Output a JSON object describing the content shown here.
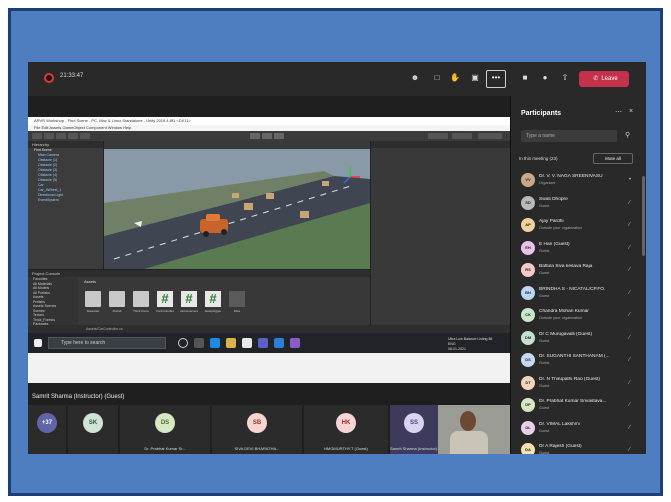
{
  "meeting": {
    "timer": "21:33:47",
    "more_label": "•••",
    "leave_label": "Leave",
    "presenter_label": "Samrit Sharma (Instructor) (Guest)"
  },
  "unity": {
    "window_title": "ARVR Workshop - Find Scene - PC, Mac & Linux Standalone - Unity 2019.4.8f1 <DX11>",
    "menu": "File  Edit  Assets  GameObject  Component  Window  Help",
    "hierarchy_title": "Hierarchy",
    "hierarchy_items": [
      "Find Scene",
      "Main Camera",
      "Obstacle (1)",
      "Obstacle (2)",
      "Obstacle (3)",
      "Obstacle (4)",
      "Obstacle (5)",
      "Car",
      "Car_4Wheel_1",
      "Directional Light",
      "EventSystem"
    ],
    "project_title": "Project   Console",
    "project_tree": [
      "Favorites",
      "All Materials",
      "All Models",
      "All Prefabs",
      "Assets",
      "Prefabs",
      "Assets Scenes",
      "Scenes",
      "Terrain",
      "Thick_Forests",
      "Packages"
    ],
    "assets_crumb": "Assets",
    "assets": [
      {
        "type": "folder",
        "name": "Materials"
      },
      {
        "type": "folder",
        "name": "Prefab"
      },
      {
        "type": "folder",
        "name": "Thick Fores"
      },
      {
        "type": "script",
        "name": "CarController"
      },
      {
        "type": "script",
        "name": "carmovement"
      },
      {
        "type": "script",
        "name": "deskptrigger"
      },
      {
        "type": "file",
        "name": "Files"
      }
    ],
    "status_path": "Assets/CarController.cs"
  },
  "taskbar": {
    "search_placeholder": "Type here to search",
    "tray_line1": "Ultra Low Balance  Listing 86",
    "tray_line2": "ENG",
    "tray_line3": "08-01-2021"
  },
  "tiles": [
    {
      "initials": "+37",
      "name": "",
      "bg": "#6264a7",
      "fg": "#ffffff"
    },
    {
      "initials": "SK",
      "name": "",
      "bg": "#cfe3d6",
      "fg": "#2b5c3b"
    },
    {
      "initials": "DS",
      "name": "Dr. Prabhat Kumar Sr...",
      "bg": "#d8e8c4",
      "fg": "#4d6b28"
    },
    {
      "initials": "SB",
      "name": "SIVA DEVI BHARATHA...",
      "bg": "#f6d6cf",
      "fg": "#a03a24"
    },
    {
      "initials": "HK",
      "name": "HMGMURTHY.T (Guest)",
      "bg": "#f8d5d5",
      "fg": "#9c2f2f"
    },
    {
      "initials": "SS",
      "name": "Samrit Sharma (Instructor)...",
      "bg": "#d8d3f0",
      "fg": "#4b3f8c"
    }
  ],
  "participants": {
    "title": "Participants",
    "search_placeholder": "Type a name",
    "section_label": "In this meeting (23)",
    "mute_all": "Mute all",
    "list": [
      {
        "initials": "VV",
        "name": "Dr. V. V. NAGA SREENIVASU",
        "role": "Organizer",
        "bg": "#c8a98c"
      },
      {
        "initials": "SD",
        "name": "Swati Dhopre",
        "role": "Guest",
        "bg": "#b9b9b9"
      },
      {
        "initials": "AP",
        "name": "Ajay Pardhi",
        "role": "Outside your organization",
        "bg": "#f2d39a"
      },
      {
        "initials": "EH",
        "name": "E Hari (Guest)",
        "role": "Guest",
        "bg": "#e7c3e8"
      },
      {
        "initials": "RS",
        "name": "Battula Siva kesava Raja",
        "role": "Guest",
        "bg": "#f7c8c8"
      },
      {
        "initials": "BN",
        "name": "BRINDHA S - NICATAL/CP.FO.",
        "role": "Guest",
        "bg": "#bcd7f3"
      },
      {
        "initials": "CK",
        "name": "Chandra Mohan Kumar",
        "role": "Outside your organization",
        "bg": "#c9e7c9"
      },
      {
        "initials": "DM",
        "name": "Dr C Murugavalli (Guest)",
        "role": "Guest",
        "bg": "#c6e0cf"
      },
      {
        "initials": "DS",
        "name": "Dr. SUGANTHI SANTHANAM (...",
        "role": "Guest",
        "bg": "#c7d9f2"
      },
      {
        "initials": "DT",
        "name": "Dr. N Thirupathi Rao (Guest)",
        "role": "Guest",
        "bg": "#f2d5bb"
      },
      {
        "initials": "DP",
        "name": "Dr. Prabhat Kumar Srivastava...",
        "role": "Guest",
        "bg": "#d8e8c4"
      },
      {
        "initials": "DL",
        "name": "Dr. VIMAL Lakshmi",
        "role": "Guest",
        "bg": "#e9d0ea"
      },
      {
        "initials": "DA",
        "name": "Dr A Rajesh (Guest)",
        "role": "Guest",
        "bg": "#f4e3b0"
      },
      {
        "initials": "GV",
        "name": "G VENKATESWARLU",
        "role": "Guest",
        "bg": "#cde6e8"
      }
    ]
  }
}
